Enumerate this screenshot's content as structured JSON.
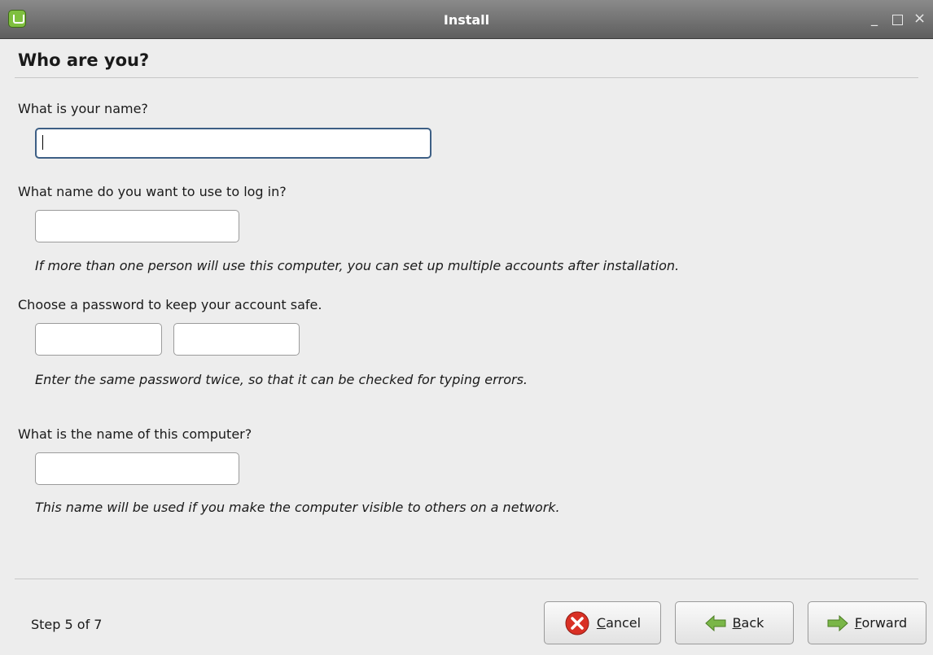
{
  "window": {
    "title": "Install"
  },
  "page": {
    "heading": "Who are you?"
  },
  "form": {
    "name_label": "What is your name?",
    "name_value": "",
    "login_label": "What name do you want to use to log in?",
    "login_value": "",
    "login_hint": "If more than one person will use this computer, you can set up multiple accounts after installation.",
    "password_label": "Choose a password to keep your account safe.",
    "password_value": "",
    "password_confirm_value": "",
    "password_hint": "Enter the same password twice, so that it can be checked for typing errors.",
    "hostname_label": "What is the name of this computer?",
    "hostname_value": "",
    "hostname_hint": "This name will be used if you make the computer visible to others on a network."
  },
  "footer": {
    "step": "Step 5 of 7",
    "cancel": {
      "mnemonic": "C",
      "rest": "ancel"
    },
    "back": {
      "mnemonic": "B",
      "rest": "ack"
    },
    "forward": {
      "mnemonic": "F",
      "rest": "orward"
    }
  },
  "icons": {
    "app": "linux-mint-icon",
    "cancel": "cancel-icon",
    "back": "back-arrow-icon",
    "forward": "forward-arrow-icon"
  },
  "colors": {
    "cancel_icon": "#d93025",
    "arrow_icon": "#7ab648",
    "focus_border": "#3d5f85"
  }
}
